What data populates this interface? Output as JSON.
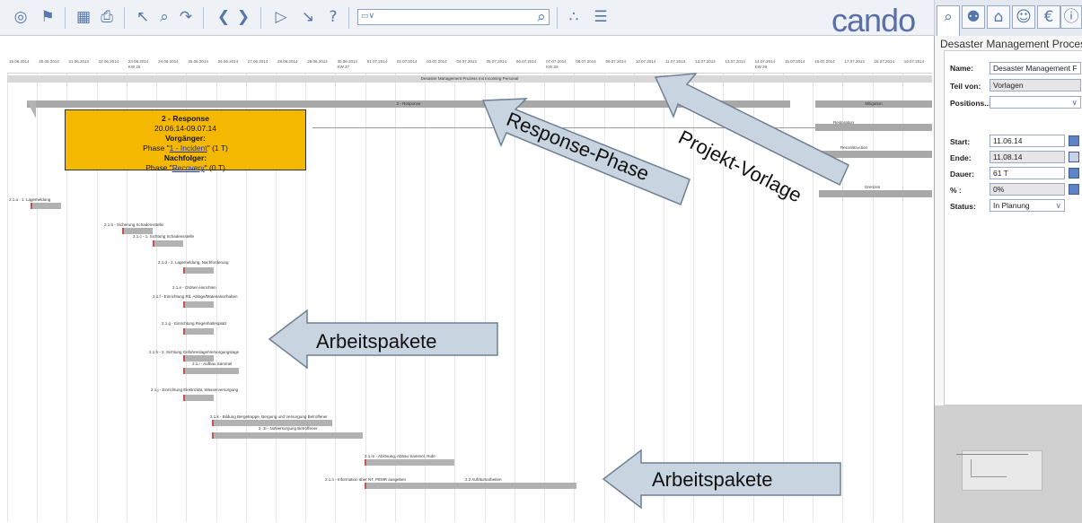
{
  "brand": "cando",
  "toolbar": {
    "icons": [
      "eye-icon",
      "flag-icon",
      "chart-save-icon",
      "print-icon",
      "cursor-icon",
      "search-icon",
      "link-icon",
      "previous-icon",
      "next-icon",
      "play-icon",
      "trend-icon",
      "help-icon",
      "filter-icon",
      "search-icon",
      "scatter-icon",
      "list-icon"
    ],
    "combo_value": ""
  },
  "timeline": {
    "dates": [
      "19.06.2014",
      "20.06.2014",
      "21.06.2014",
      "22.06.2014",
      "23.06.2014",
      "24.06.2014",
      "25.06.2014",
      "26.06.2014",
      "27.06.2014",
      "28.06.2014",
      "29.06.2014",
      "30.06.2014",
      "01.07.2014",
      "02.07.2014",
      "03.07.2014",
      "04.07.2014",
      "05.07.2014",
      "06.07.2014",
      "07.07.2014",
      "08.07.2014",
      "09.07.2014",
      "10.07.2014",
      "11.07.2014",
      "12.07.2014",
      "13.07.2014",
      "14.07.2014",
      "15.07.2014",
      "16.07.2014",
      "17.07.2014",
      "18.07.2014",
      "19.07.2014"
    ],
    "week_labels": [
      "KW 26",
      "KW 27",
      "KW 28",
      "KW 29"
    ],
    "project_bar_label": "Desaster Management Prozess mit Incoming Personal",
    "phases": [
      {
        "label": "2 - Response"
      },
      {
        "label": "Mitigation"
      },
      {
        "label": "Restoration"
      },
      {
        "label": "Reconstruction"
      },
      {
        "label": "Grenzen"
      }
    ],
    "tasks": [
      {
        "label": "2.1.a - 1. Lagemeldung"
      },
      {
        "label": "2.1.b - Sicherung Schadensstelle"
      },
      {
        "label": "2.1.c - 1. Sichtung Schadensstelle"
      },
      {
        "label": "2.1.d - 2. Lagemeldung, Nachforderung"
      },
      {
        "label": "2.1.e - Ordner einrichten"
      },
      {
        "label": "2.1.f - Einrichtung Rd. Ablage/Materialvorhaben"
      },
      {
        "label": "2.1.g - Einrichtung Regenhaltesplatz"
      },
      {
        "label": "2.1.h - 2. Sichtung Gefahrenlage/Versorgungslage"
      },
      {
        "label": "2.1.i - Aufbau Sammel"
      },
      {
        "label": "2.1.j - Einrichtung Elektrizität, Wasserversorgung"
      },
      {
        "label": "2.1.k - Bildung Bergetruppe, Bergung und Versorgung Betroffener"
      },
      {
        "label": "2. 1l - Notversorgung Betroffener"
      },
      {
        "label": "2.1.m - Ablösung, Abbau Sammel, Rufe"
      },
      {
        "label": "2.1.n - Information über NT, PEMR ausgeben"
      },
      {
        "label": "2.2 Aufräumarbeiten"
      }
    ]
  },
  "tooltip": {
    "title": "2 - Response",
    "dates": "20.06.14-09.07.14",
    "pred_heading": "Vorgänger:",
    "pred_prefix": "Phase \"",
    "pred_link": "1 - Incident",
    "pred_suffix": "\" (1 T)",
    "succ_heading": "Nachfolger:",
    "succ_prefix": "Phase \"",
    "succ_link": "Recovery",
    "succ_suffix": "\" (0 T)"
  },
  "callouts": {
    "projekt_vorlage": "Projekt-Vorlage",
    "response_phase": "Response-Phase",
    "arbeitspakete_mid": "Arbeitspakete",
    "arbeitspakete_bottom": "Arbeitspakete"
  },
  "side_tabs": [
    "search-icon",
    "lightbulb-icon",
    "lock-icon",
    "person-icon",
    "euro-icon",
    "info-icon"
  ],
  "panel": {
    "title": "Desaster Management Proces",
    "name_label": "Name:",
    "name_value": "Desaster Management F",
    "teil_label": "Teil von:",
    "teil_value": "Vorlagen",
    "pos_label": "Positions...",
    "pos_value": "",
    "start_label": "Start:",
    "start_value": "11.06.14",
    "ende_label": "Ende:",
    "ende_value": "11.08.14",
    "dauer_label": "Dauer:",
    "dauer_value": "61 T",
    "pct_label": "% :",
    "pct_value": "0%",
    "status_label": "Status:",
    "status_value": "In Planung"
  },
  "colors": {
    "callout_fill": "#c8d4e0",
    "callout_stroke": "#6e8094",
    "tooltip_bg": "#f5b800",
    "toolbar_icon": "#5577aa"
  }
}
